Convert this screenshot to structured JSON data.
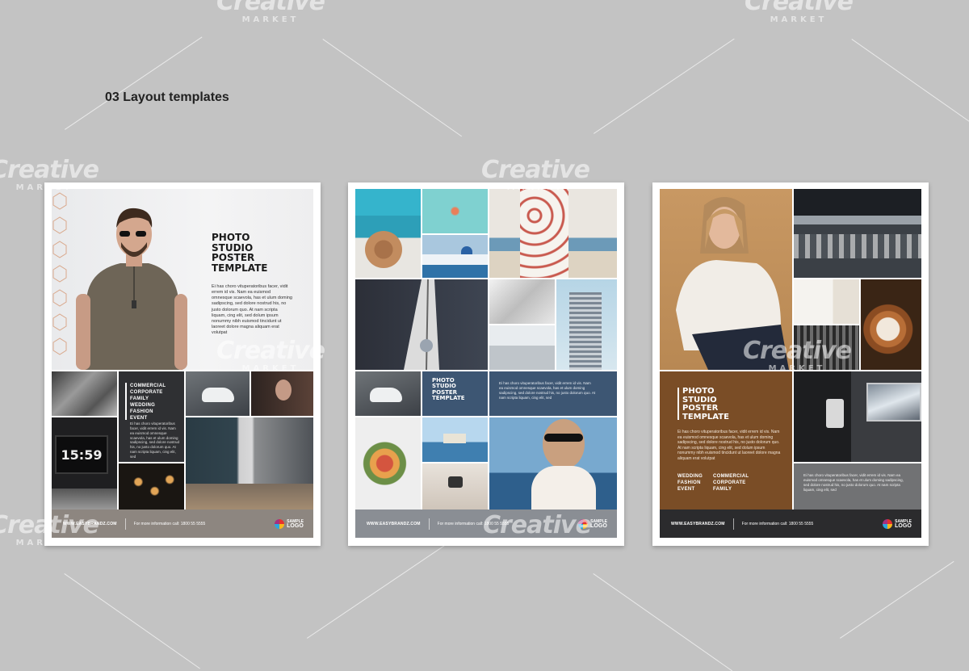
{
  "page": {
    "heading": "03 Layout templates"
  },
  "watermark": {
    "brand": "Creative",
    "sub": "MARKET"
  },
  "posters": [
    {
      "title": [
        "PHOTO",
        "STUDIO",
        "POSTER",
        "TEMPLATE"
      ],
      "body": "Ei has choro vituperatoribus facer, vidit errem id vis. Nam ea euismod omnesque scaevola, has et ulum doming sadipscing, sed dolore nostrud his, no justo dolorum quo. At nam scripta liquam, cing elit, sed dolum ipsum nonummy nibh euismod tincidunt ut laoreet dolore magna aliquam erat volutpat",
      "list": [
        "COMMERCIAL",
        "CORPORATE",
        "FAMILY",
        "WEDDING",
        "FASHION",
        "EVENT"
      ],
      "panel_body": "Ei has choro vituperatoribus facer, vidit errem id vis. Nam ea euismod omnesque scaevola, has et ulum doming sadipscing, sed dolore nostrud his, no justo dolorum quo. At nam scripta liquam, cing elit, sed",
      "footer_url": "WWW.EASYBRANDZ.COM",
      "footer_info": "For more information call: 1800 55 5555",
      "logo_top": "SAMPLE",
      "logo_bottom": "LOGO",
      "clock": "15:59"
    },
    {
      "title": [
        "PHOTO",
        "STUDIO",
        "POSTER",
        "TEMPLATE"
      ],
      "body": "Ei has choro vituperatoribus facer, vidit errem id vis. Nam ea euismod omnesque scaevola, has et ulum doming sadipscing, sed dolore nostrud his, no justo dolorum quo. At nam scripta liquam, cing elit, sed",
      "footer_url": "WWW.EASYBRANDZ.COM",
      "footer_info": "For more information call: 1800 55 5555",
      "logo_top": "SAMPLE",
      "logo_bottom": "LOGO"
    },
    {
      "title": [
        "PHOTO",
        "STUDIO",
        "POSTER",
        "TEMPLATE"
      ],
      "body": "Ei has choro vituperatoribus facer, vidit errem id vis. Nam ea euismod omnesque scaevola, has et ulum doming sadipscing, sed dolore nostrud his, no justo dolorum quo. At nam scripta liquam, cing elit, sed dolum ipsum nonummy nibh euismod tincidunt ut laoreet dolore magna aliquam erat volutpat",
      "list_a": [
        "WEDDING",
        "FASHION",
        "EVENT"
      ],
      "list_b": [
        "COMMERCIAL",
        "CORPORATE",
        "FAMILY"
      ],
      "side_body": "Ei has choro vituperatoribus facer, vidit errem id vis. Nam ea euismod omnesque scaevola, has et ulum doming sadipscing, sed dolore nostrud his, no justo dolorum quo. At nam scripta liquam, cing elit, sed",
      "footer_url": "WWW.EASYBRANDZ.COM",
      "footer_info": "For more information call: 1800 55 5555",
      "logo_top": "SAMPLE",
      "logo_bottom": "LOGO"
    }
  ],
  "colors": {
    "background": "#c3c3c3",
    "dark_panel": "#2f3033",
    "slate_blue": "#3d5673",
    "brown": "#7a4d26",
    "footer_taupe": "#8d8680",
    "footer_grey": "#8a8e94",
    "footer_dark": "#2b2b2d"
  }
}
